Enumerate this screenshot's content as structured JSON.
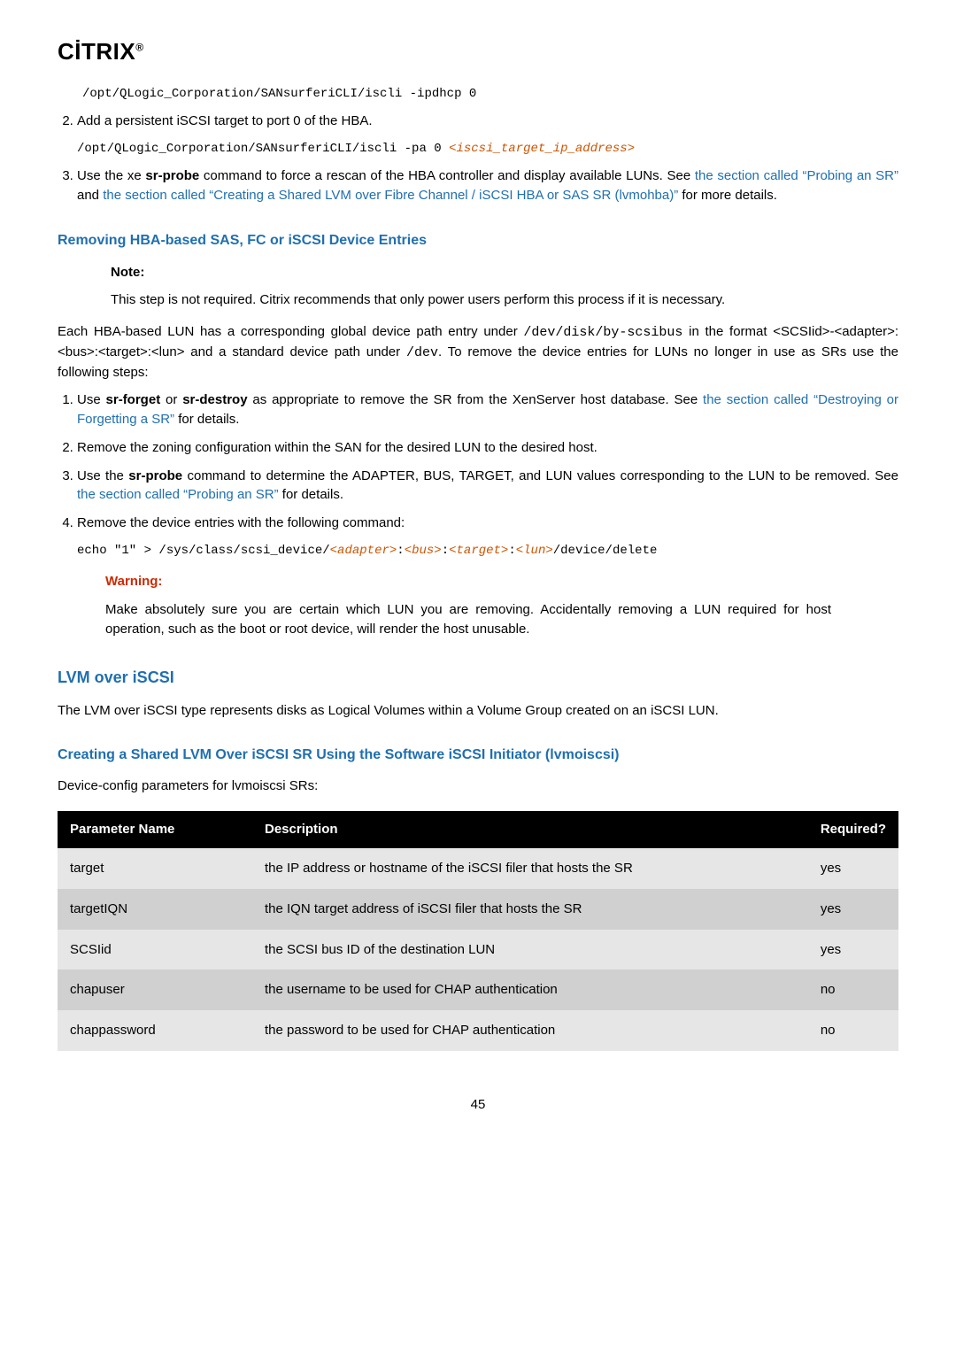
{
  "logo": "CİTRIX",
  "cmd1": "/opt/QLogic_Corporation/SANsurferiCLI/iscli -ipdhcp 0",
  "step2_text": "Add a persistent iSCSI target to port 0 of the HBA.",
  "cmd2_a": "/opt/QLogic_Corporation/SANsurferiCLI/iscli -pa 0 ",
  "cmd2_var": "<iscsi_target_ip_address>",
  "step3_a": "Use the xe ",
  "step3_bold": "sr-probe",
  "step3_b": " command to force a rescan of the HBA controller and display available LUNs. See ",
  "step3_link1": "the section called “Probing an SR”",
  "step3_c": " and ",
  "step3_link2": "the section called “Creating a Shared LVM over Fibre Channel / iSCSI HBA or SAS SR (lvmohba)”",
  "step3_d": " for more details.",
  "h_remove": "Removing HBA-based SAS, FC or iSCSI Device Entries",
  "note_label": "Note:",
  "note_text": "This step is not required. Citrix recommends that only power users perform this process if it is necessary.",
  "para_each_a": "Each HBA-based LUN has a corresponding global device path entry under ",
  "para_each_mono1": "/dev/disk/by-scsibus",
  "para_each_b": " in the format <SCSIid>-<adapter>:<bus>:<target>:<lun> and a standard device path under ",
  "para_each_mono2": "/dev",
  "para_each_c": ". To remove the device entries for LUNs no longer in use as SRs use the following steps:",
  "s1_a": "Use ",
  "s1_bold1": "sr-forget",
  "s1_or": " or ",
  "s1_bold2": "sr-destroy",
  "s1_b": " as appropriate to remove the SR from the XenServer host database. See ",
  "s1_link": "the section called “Destroying or Forgetting a SR”",
  "s1_c": " for details.",
  "s2": "Remove the zoning configuration within the SAN for the desired LUN to the desired host.",
  "s3_a": "Use the ",
  "s3_bold": "sr-probe",
  "s3_b": " command to determine the ADAPTER, BUS, TARGET, and LUN values corresponding to the LUN to be removed. See ",
  "s3_link": "the section called “Probing an SR”",
  "s3_c": " for details.",
  "s4": "Remove the device entries with the following command:",
  "echo_a": "echo \"1\" > /sys/class/scsi_device/",
  "echo_v1": "<adapter>",
  "echo_colon": ":",
  "echo_v2": "<bus>",
  "echo_v3": "<target>",
  "echo_v4": "<lun>",
  "echo_b": "/device/delete",
  "warn_label": "Warning:",
  "warn_text": "Make absolutely sure you are certain which LUN you are removing. Accidentally removing a LUN required for host operation, such as the boot or root device, will render the host unusable.",
  "h_lvm": "LVM over iSCSI",
  "lvm_para": "The LVM over iSCSI type represents disks as Logical Volumes within a Volume Group created on an iSCSI LUN.",
  "h_create": "Creating a Shared LVM Over iSCSI SR Using the Software iSCSI Initiator (lvmoiscsi)",
  "devcfg": "Device-config parameters for lvmoiscsi SRs:",
  "table": {
    "headers": [
      "Parameter Name",
      "Description",
      "Required?"
    ],
    "rows": [
      {
        "name": "target",
        "desc": "the IP address or hostname of the iSCSI filer that hosts the SR",
        "req": "yes"
      },
      {
        "name": "targetIQN",
        "desc": "the IQN target address of iSCSI filer that hosts the SR",
        "req": "yes"
      },
      {
        "name": "SCSIid",
        "desc": "the SCSI bus ID of the destination LUN",
        "req": "yes"
      },
      {
        "name": "chapuser",
        "desc": "the username to be used for CHAP authentication",
        "req": "no"
      },
      {
        "name": "chappassword",
        "desc": "the password to be used for CHAP authentication",
        "req": "no"
      }
    ]
  },
  "pagenum": "45"
}
